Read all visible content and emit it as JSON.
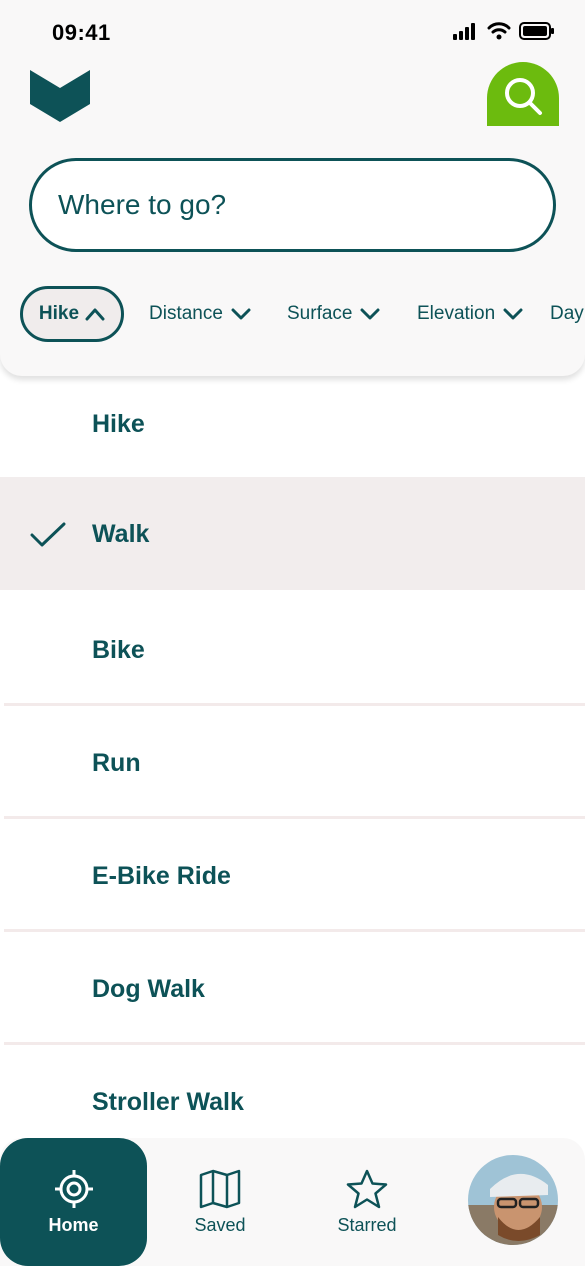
{
  "status_bar": {
    "time": "09:41"
  },
  "header": {
    "search_placeholder": "Where to go?",
    "filters": [
      {
        "label": "Hike",
        "active": true
      },
      {
        "label": "Distance"
      },
      {
        "label": "Surface"
      },
      {
        "label": "Elevation"
      },
      {
        "label": "Day"
      }
    ]
  },
  "activity_list": {
    "items": [
      {
        "label": "Hike"
      },
      {
        "label": "Walk",
        "selected": true
      },
      {
        "label": "Bike"
      },
      {
        "label": "Run"
      },
      {
        "label": "E-Bike Ride"
      },
      {
        "label": "Dog Walk"
      },
      {
        "label": "Stroller Walk"
      }
    ]
  },
  "bottom_nav": {
    "items": [
      {
        "label": "Home",
        "icon": "target-icon",
        "active": true
      },
      {
        "label": "Saved",
        "icon": "map-icon"
      },
      {
        "label": "Starred",
        "icon": "star-icon"
      }
    ]
  },
  "colors": {
    "primary": "#0d5257",
    "accent": "#6cbb0e",
    "selected_row": "#f2eded",
    "header_bg": "#f9f8f8"
  }
}
